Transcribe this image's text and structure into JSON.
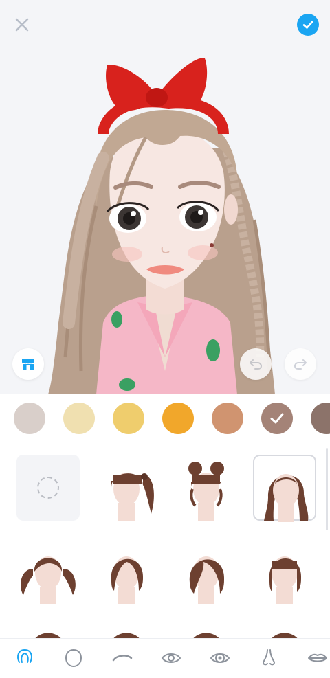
{
  "toolbar": {
    "close_icon": "close-icon",
    "done_icon": "checkmark-circle-icon",
    "accent_color": "#1aa5f2"
  },
  "preview": {
    "shop_icon": "shop-icon",
    "undo_icon": "undo-icon",
    "redo_icon": "redo-icon"
  },
  "hair_colors": {
    "selected_index": 5,
    "swatches": [
      "#d9cfca",
      "#f0e0b0",
      "#efcd6d",
      "#f1a72b",
      "#d09470",
      "#a48377",
      "#8c736a"
    ]
  },
  "hairstyles": {
    "selected_index": 3,
    "items": [
      "none",
      "side-ponytail-bangs",
      "double-buns-bangs",
      "long-wavy",
      "twin-tails",
      "short-bob",
      "side-part-bob",
      "bob-bangs"
    ]
  },
  "tabs": {
    "active_index": 0,
    "items": [
      "hair-icon",
      "face-shape-icon",
      "eyebrow-icon",
      "eye-icon",
      "eye-color-icon",
      "nose-icon",
      "lips-icon"
    ]
  }
}
